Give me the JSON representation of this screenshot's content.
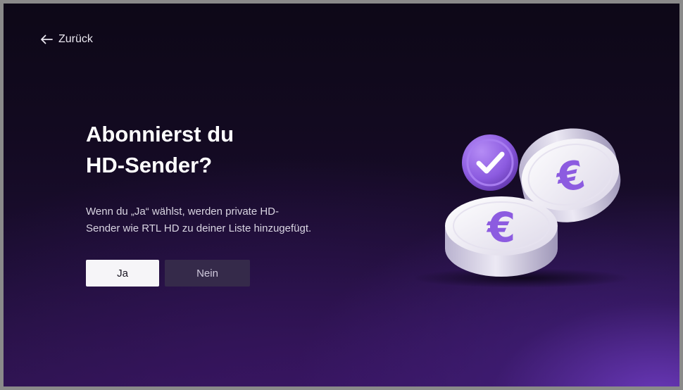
{
  "header": {
    "back_label": "Zurück",
    "back_icon": "arrow-left-icon"
  },
  "main": {
    "title": "Abonnierst du\nHD-Sender?",
    "description": "Wenn du „Ja“ wählst, werden private HD-\nSender wie RTL HD zu deiner Liste hinzugefügt.",
    "buttons": {
      "yes_label": "Ja",
      "no_label": "Nein"
    }
  },
  "illustration": {
    "icons": [
      "checkmark-badge-icon",
      "euro-coin-icon",
      "euro-coin-icon"
    ],
    "accent_color": "#8c5be0"
  },
  "colors": {
    "background": "#130a21",
    "accent": "#8c5be0",
    "button_primary": "#f6f5f8",
    "button_secondary": "#352a4a"
  }
}
